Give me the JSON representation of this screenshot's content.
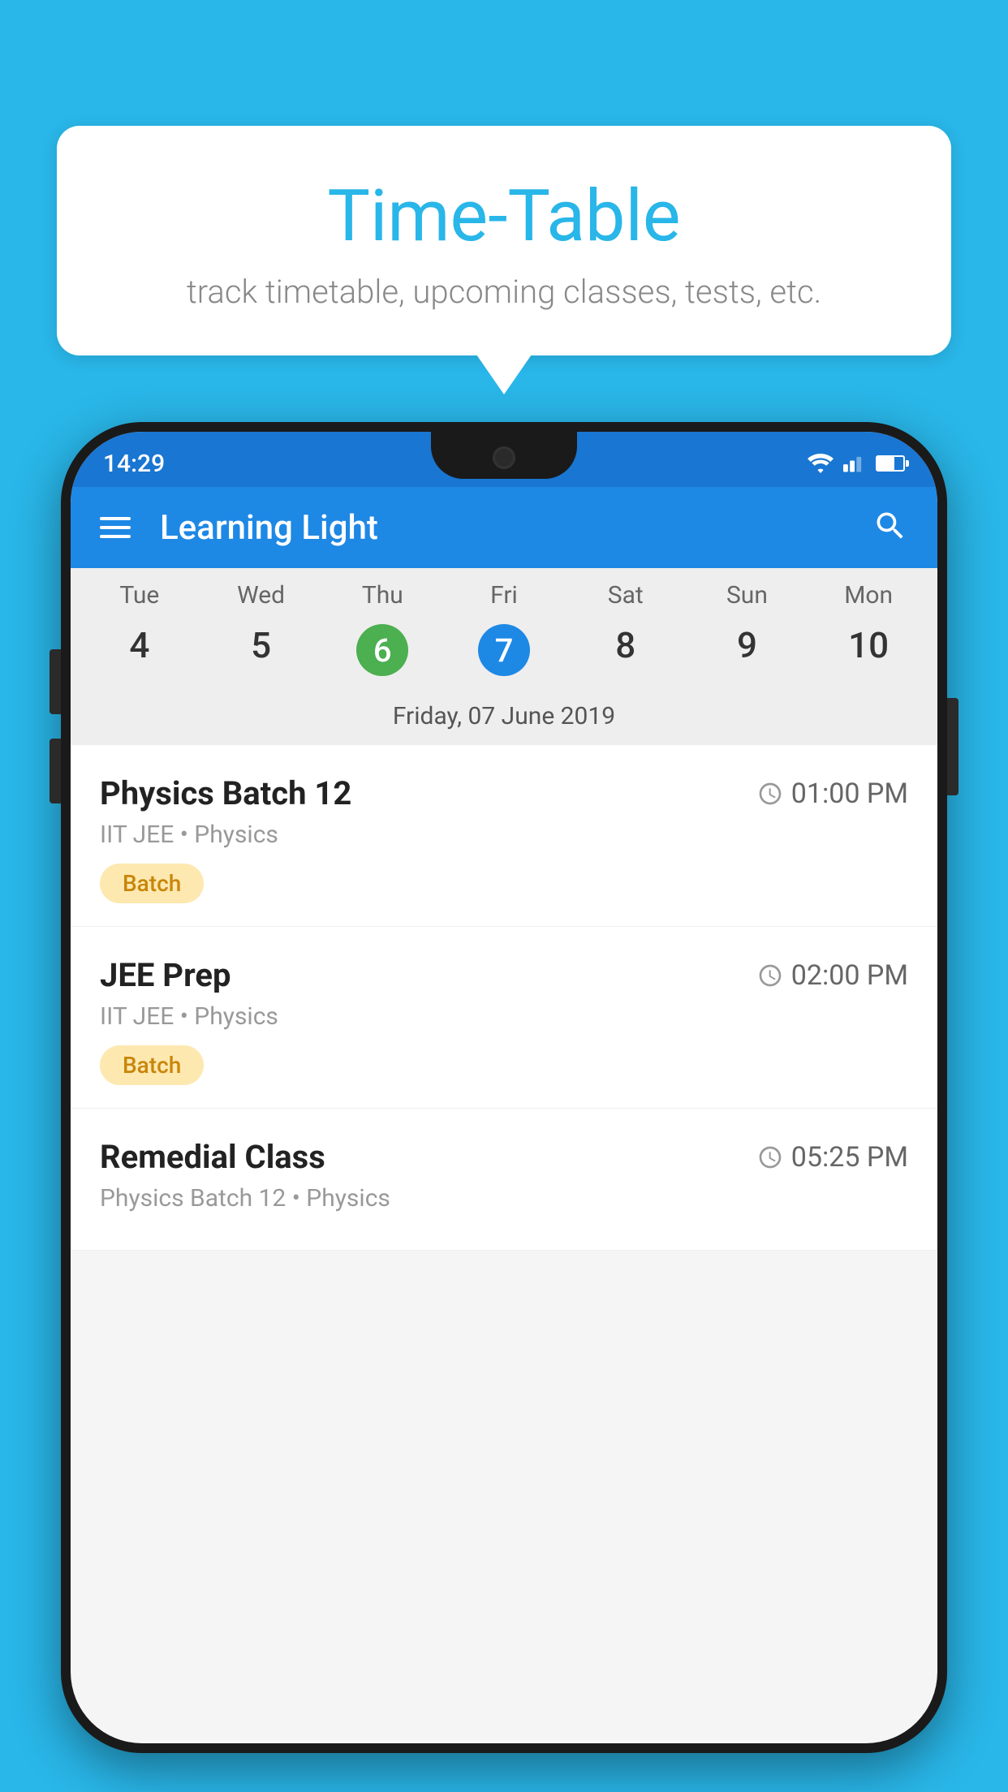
{
  "background_color": "#29b6e8",
  "speech_bubble": {
    "title": "Time-Table",
    "subtitle": "track timetable, upcoming classes, tests, etc."
  },
  "phone": {
    "status_bar": {
      "time": "14:29"
    },
    "app_bar": {
      "title": "Learning Light",
      "search_label": "Search"
    },
    "calendar": {
      "days": [
        {
          "label": "Tue",
          "number": "4"
        },
        {
          "label": "Wed",
          "number": "5"
        },
        {
          "label": "Thu",
          "number": "6",
          "state": "today"
        },
        {
          "label": "Fri",
          "number": "7",
          "state": "selected"
        },
        {
          "label": "Sat",
          "number": "8"
        },
        {
          "label": "Sun",
          "number": "9"
        },
        {
          "label": "Mon",
          "number": "10"
        }
      ],
      "selected_date": "Friday, 07 June 2019"
    },
    "classes": [
      {
        "name": "Physics Batch 12",
        "time": "01:00 PM",
        "subtitle": "IIT JEE • Physics",
        "badge": "Batch"
      },
      {
        "name": "JEE Prep",
        "time": "02:00 PM",
        "subtitle": "IIT JEE • Physics",
        "badge": "Batch"
      },
      {
        "name": "Remedial Class",
        "time": "05:25 PM",
        "subtitle": "Physics Batch 12 • Physics",
        "badge": ""
      }
    ]
  }
}
